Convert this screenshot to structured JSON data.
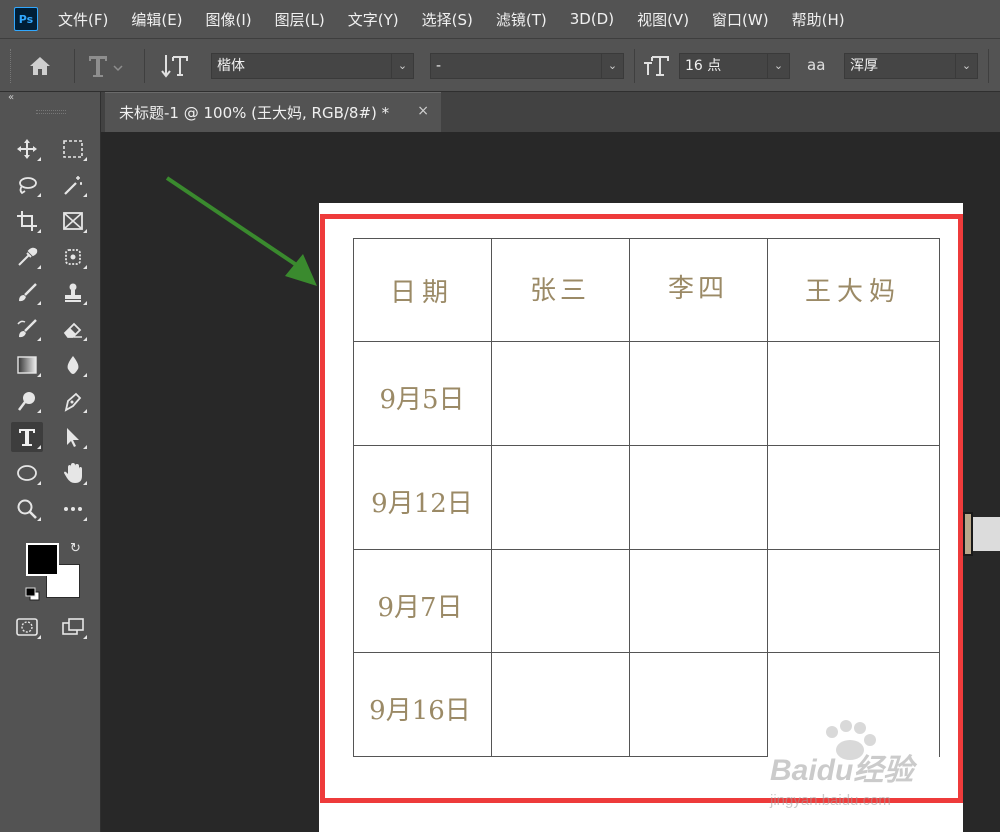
{
  "app": {
    "logo_text": "Ps"
  },
  "menu": [
    "文件(F)",
    "编辑(E)",
    "图像(I)",
    "图层(L)",
    "文字(Y)",
    "选择(S)",
    "滤镜(T)",
    "3D(D)",
    "视图(V)",
    "窗口(W)",
    "帮助(H)"
  ],
  "options": {
    "font_family": "楷体",
    "font_style": "-",
    "font_size": "16 点",
    "aa_label": "aa",
    "antialias": "浑厚"
  },
  "tab": {
    "title": "未标题-1 @ 100% (王大妈, RGB/8#) *",
    "close": "×"
  },
  "table": {
    "headers": [
      "日期",
      "张三",
      "李四",
      "王大妈"
    ],
    "rows": [
      [
        "9月5日",
        "",
        "",
        ""
      ],
      [
        "9月12日",
        "",
        "",
        ""
      ],
      [
        "9月7日",
        "",
        "",
        ""
      ],
      [
        "9月16日",
        "",
        "",
        ""
      ]
    ]
  },
  "colors": {
    "foreground": "#000000",
    "background": "#ffffff",
    "highlight_box": "#ee3b3b",
    "arrow": "#3a8a2e",
    "cell_text": "#9b8a66"
  },
  "watermark": {
    "brand": "Baidu经验",
    "site": "jingyan.baidu.com"
  },
  "tools": [
    "move-icon",
    "marquee-icon",
    "lasso-icon",
    "magic-wand-icon",
    "crop-icon",
    "frame-icon",
    "eyedropper-icon",
    "healing-icon",
    "brush-icon",
    "stamp-icon",
    "history-brush-icon",
    "eraser-icon",
    "gradient-icon",
    "blur-icon",
    "dodge-icon",
    "pen-icon",
    "type-icon",
    "path-select-icon",
    "ellipse-icon",
    "hand-icon",
    "zoom-icon",
    "more-icon"
  ]
}
